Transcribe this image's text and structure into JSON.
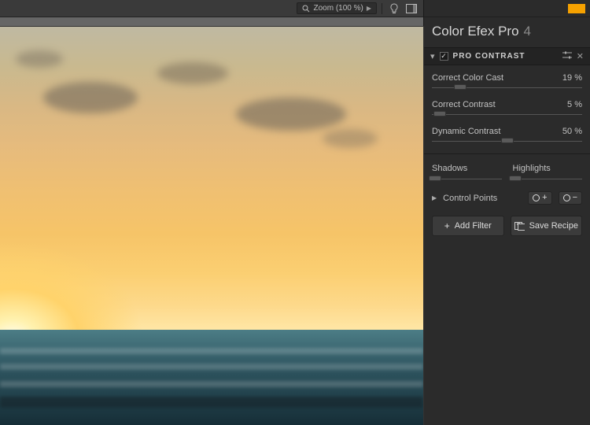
{
  "toolbar": {
    "zoom_label": "Zoom (100 %)"
  },
  "panel": {
    "title": "Color Efex Pro",
    "version": "4",
    "section": {
      "name": "PRO CONTRAST",
      "checked": true
    },
    "sliders": [
      {
        "label": "Correct Color Cast",
        "value": "19 %",
        "pct": 19
      },
      {
        "label": "Correct Contrast",
        "value": "5 %",
        "pct": 5
      },
      {
        "label": "Dynamic Contrast",
        "value": "50 %",
        "pct": 50
      }
    ],
    "shadows_label": "Shadows",
    "highlights_label": "Highlights",
    "shadows_pct": 4,
    "highlights_pct": 4,
    "control_points_label": "Control Points",
    "add_filter_label": "Add Filter",
    "save_recipe_label": "Save Recipe"
  }
}
